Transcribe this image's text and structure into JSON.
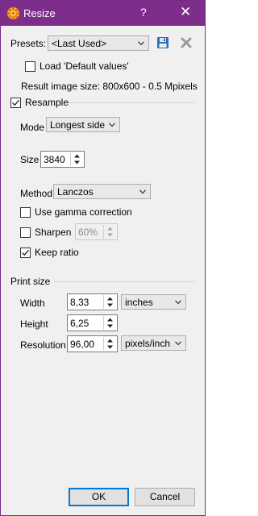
{
  "window": {
    "title": "Resize",
    "help_glyph": "?",
    "close_glyph": "✕",
    "app_icon": "xnview-icon"
  },
  "presets": {
    "label": "Presets:",
    "selected": "<Last Used>",
    "save_icon": "floppy-disk-icon",
    "delete_icon": "delete-x-icon"
  },
  "load_default": {
    "label": "Load 'Default values'",
    "checked": false
  },
  "result": {
    "text": "Result image size: 800x600 - 0.5 Mpixels"
  },
  "resample": {
    "label": "Resample",
    "checked": true,
    "mode_label": "Mode",
    "mode_value": "Longest side",
    "size_label": "Size",
    "size_value": "3840",
    "method_label": "Method",
    "method_value": "Lanczos",
    "gamma_label": "Use gamma correction",
    "gamma_checked": false,
    "sharpen_label": "Sharpen",
    "sharpen_checked": false,
    "sharpen_value": "60%",
    "keep_ratio_label": "Keep ratio",
    "keep_ratio_checked": true
  },
  "print_size": {
    "label": "Print size",
    "width_label": "Width",
    "width_value": "8,33",
    "height_label": "Height",
    "height_value": "6,25",
    "resolution_label": "Resolution",
    "resolution_value": "96,00",
    "unit_value": "inches",
    "res_unit_value": "pixels/inch"
  },
  "buttons": {
    "ok": "OK",
    "cancel": "Cancel"
  },
  "colors": {
    "titlebar": "#7d2d8a",
    "accent": "#0078d7",
    "dialog_bg": "#f0f0f0"
  }
}
